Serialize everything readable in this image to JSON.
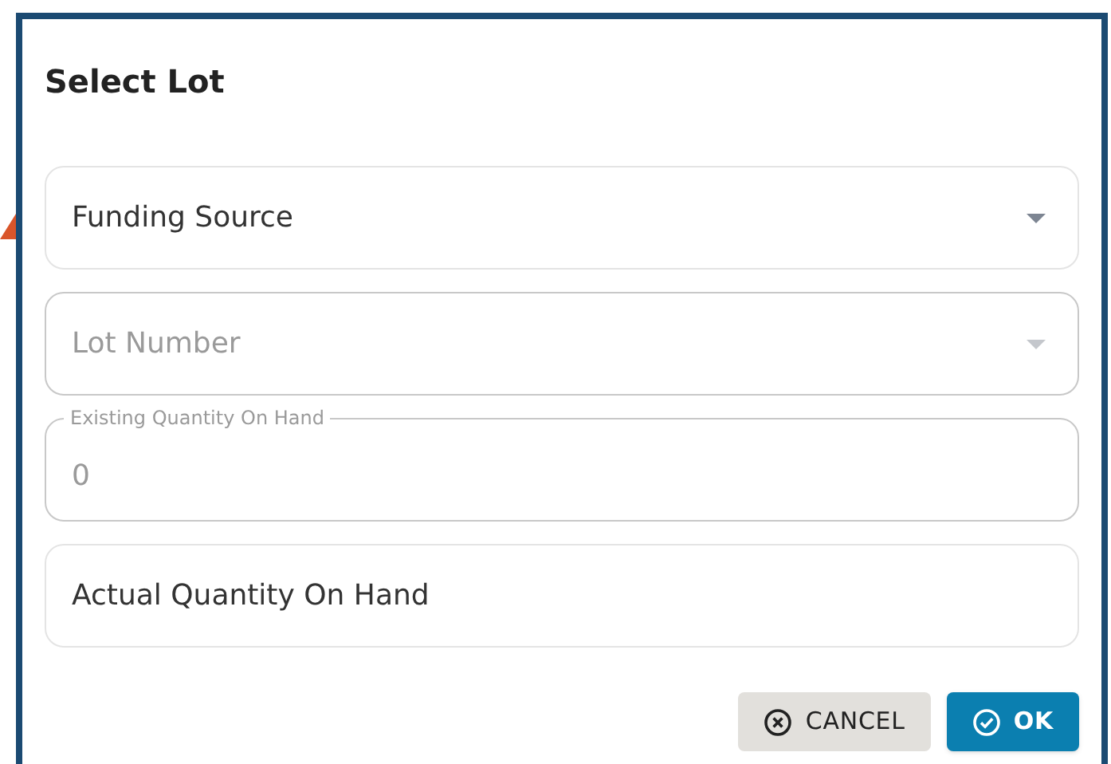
{
  "dialog": {
    "title": "Select Lot"
  },
  "fields": [
    {
      "kind": "select",
      "label": "Funding Source",
      "disabled": false
    },
    {
      "kind": "select",
      "label": "Lot Number",
      "disabled": true
    },
    {
      "kind": "outlined",
      "label": "Existing Quantity On Hand",
      "value": "0",
      "disabled": true
    },
    {
      "kind": "text",
      "label": "Actual Quantity On Hand",
      "disabled": false
    }
  ],
  "buttons": [
    {
      "kind": "cancel",
      "label": "CANCEL"
    },
    {
      "kind": "ok",
      "label": "OK"
    }
  ]
}
